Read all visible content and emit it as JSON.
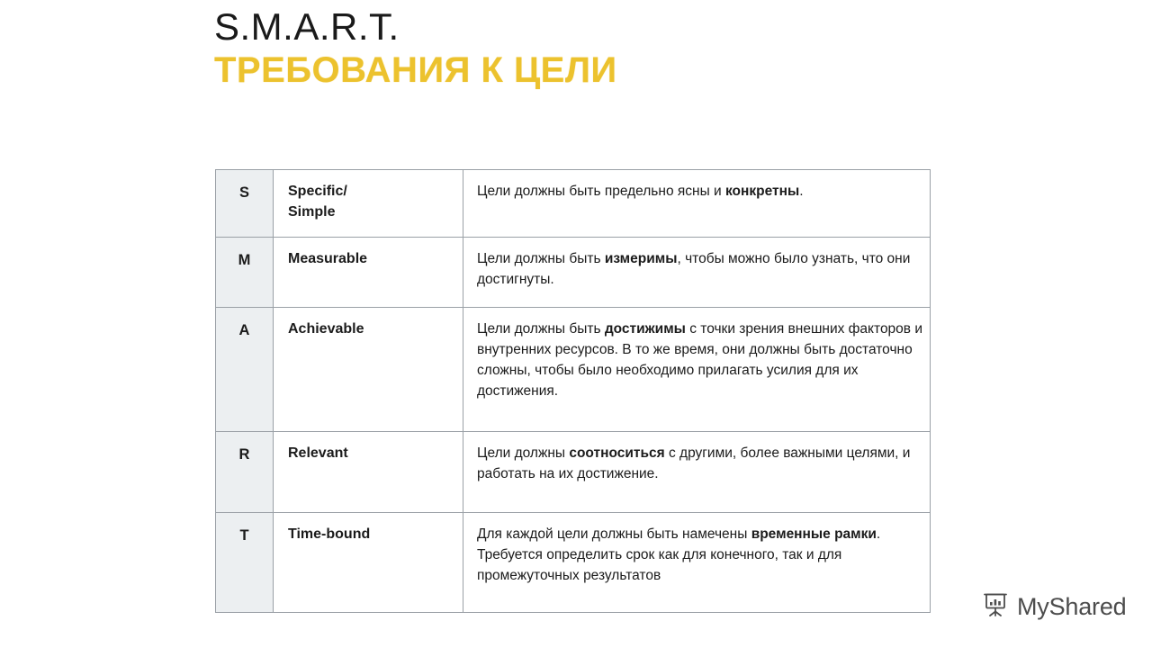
{
  "slide": {
    "title_main": "S.M.A.R.T.",
    "title_sub": "ТРЕБОВАНИЯ К ЦЕЛИ",
    "title_main_color": "#1a1a1a",
    "title_sub_color": "#ecc22e"
  },
  "table": {
    "letter_column_bg": "#eceff1",
    "border_color": "#9aa0a6",
    "rows": [
      {
        "letter": "S",
        "term": "Specific/ Simple",
        "term_line1": "Specific/",
        "term_line2": "Simple",
        "description_parts": [
          {
            "text": "Цели должны быть предельно ясны и ",
            "bold": false
          },
          {
            "text": "конкретны",
            "bold": true
          },
          {
            "text": ".",
            "bold": false
          }
        ],
        "description_plain": "Цели должны быть предельно ясны и конкретны."
      },
      {
        "letter": "M",
        "term": "Measurable",
        "term_line1": "Measurable",
        "term_line2": "",
        "description_parts": [
          {
            "text": "Цели должны быть ",
            "bold": false
          },
          {
            "text": "измеримы",
            "bold": true
          },
          {
            "text": ", чтобы можно было узнать, что они достигнуты.",
            "bold": false
          }
        ],
        "description_plain": "Цели должны быть измеримы, чтобы можно было узнать, что они достигнуты."
      },
      {
        "letter": "A",
        "term": "Achievable",
        "term_line1": "Achievable",
        "term_line2": "",
        "description_parts": [
          {
            "text": "Цели должны быть ",
            "bold": false
          },
          {
            "text": "достижимы",
            "bold": true
          },
          {
            "text": " с точки зрения внешних факторов и внутренних ресурсов. В то же время, они должны быть достаточно сложны, чтобы было необходимо прилагать усилия для их достижения.",
            "bold": false
          }
        ],
        "description_plain": "Цели должны быть достижимы с точки зрения внешних факторов и внутренних ресурсов. В то же время, они должны быть достаточно сложны, чтобы было необходимо прилагать усилия для их достижения."
      },
      {
        "letter": "R",
        "term": "Relevant",
        "term_line1": "Relevant",
        "term_line2": "",
        "description_parts": [
          {
            "text": "Цели должны ",
            "bold": false
          },
          {
            "text": "соотноситься",
            "bold": true
          },
          {
            "text": " с другими, более важными целями, и работать на их достижение.",
            "bold": false
          }
        ],
        "description_plain": "Цели должны соотноситься с другими, более важными целями, и работать на их достижение."
      },
      {
        "letter": "T",
        "term": "Time-bound",
        "term_line1": "Time-bound",
        "term_line2": "",
        "description_parts": [
          {
            "text": "Для каждой цели должны быть намечены ",
            "bold": false
          },
          {
            "text": "временные рамки",
            "bold": true
          },
          {
            "text": ". Требуется определить срок как для конечного, так и для промежуточных результатов",
            "bold": false
          }
        ],
        "description_plain": "Для каждой цели должны быть намечены временные рамки. Требуется определить срок как для конечного, так и для промежуточных результатов"
      }
    ]
  },
  "watermark": {
    "text": "MyShared",
    "icon": "presentation-chart-icon",
    "color": "#4c4c4c"
  }
}
